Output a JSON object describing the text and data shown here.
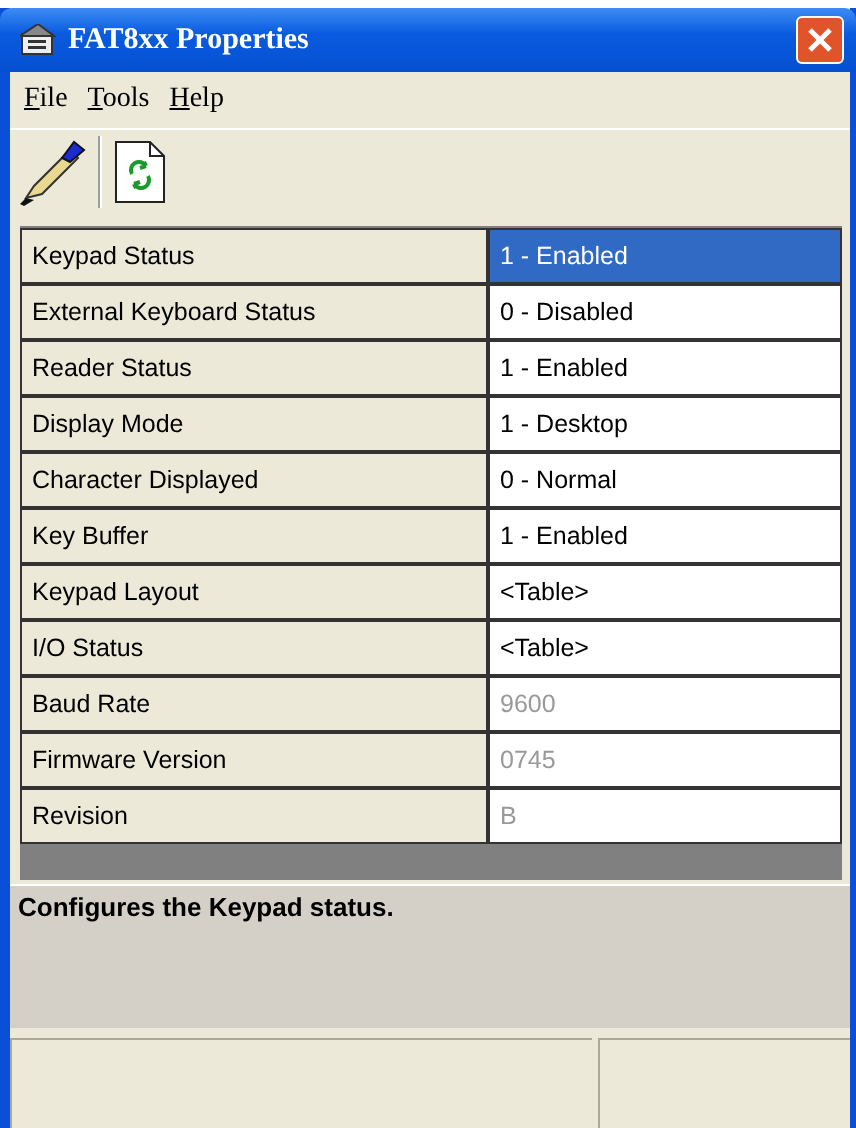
{
  "window": {
    "title": "FAT8xx Properties"
  },
  "menu": [
    {
      "label": "File"
    },
    {
      "label": "Tools"
    },
    {
      "label": "Help"
    }
  ],
  "properties": [
    {
      "name": "Keypad Status",
      "value": "1 - Enabled",
      "selected": true,
      "disabled": false
    },
    {
      "name": "External Keyboard Status",
      "value": "0 - Disabled",
      "selected": false,
      "disabled": false
    },
    {
      "name": "Reader Status",
      "value": "1 - Enabled",
      "selected": false,
      "disabled": false
    },
    {
      "name": "Display Mode",
      "value": "1 - Desktop",
      "selected": false,
      "disabled": false
    },
    {
      "name": "Character Displayed",
      "value": "0 - Normal",
      "selected": false,
      "disabled": false
    },
    {
      "name": "Key Buffer",
      "value": "1 - Enabled",
      "selected": false,
      "disabled": false
    },
    {
      "name": "Keypad Layout",
      "value": "<Table>",
      "selected": false,
      "disabled": false
    },
    {
      "name": "I/O Status",
      "value": "<Table>",
      "selected": false,
      "disabled": false
    },
    {
      "name": "Baud Rate",
      "value": "9600",
      "selected": false,
      "disabled": true
    },
    {
      "name": "Firmware Version",
      "value": "0745",
      "selected": false,
      "disabled": true
    },
    {
      "name": "Revision",
      "value": "B",
      "selected": false,
      "disabled": true
    }
  ],
  "description": "Configures the Keypad status."
}
